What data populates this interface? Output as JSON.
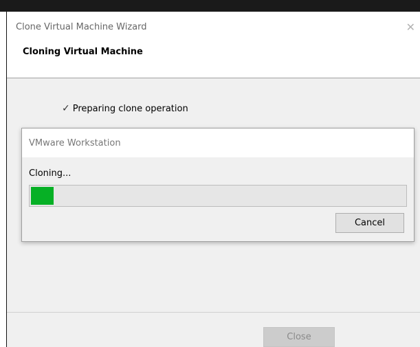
{
  "window": {
    "title": "Clone Virtual Machine Wizard",
    "close_glyph": "✕",
    "heading": "Cloning Virtual Machine"
  },
  "steps": [
    {
      "check": "✓",
      "label": "Preparing clone operation"
    }
  ],
  "progress_dialog": {
    "title": "VMware Workstation",
    "status": "Cloning...",
    "progress_fraction": 0.06,
    "progress_color": "#06b025",
    "cancel_label": "Cancel"
  },
  "footer": {
    "close_label": "Close",
    "close_enabled": false
  },
  "icons": {
    "window_close": "close-icon",
    "step_check": "checkmark-icon"
  }
}
